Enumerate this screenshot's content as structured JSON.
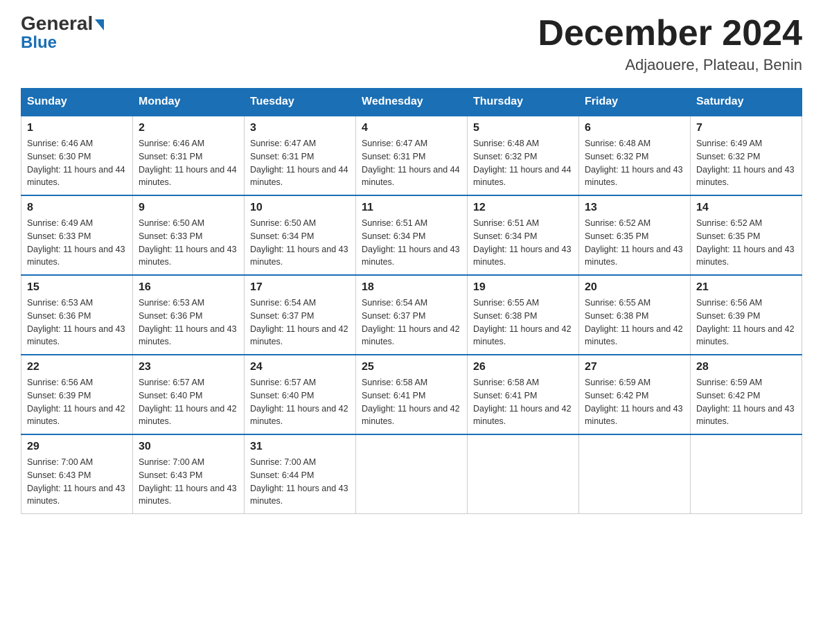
{
  "header": {
    "logo_line1": "General",
    "logo_line2": "Blue",
    "month_title": "December 2024",
    "location": "Adjaouere, Plateau, Benin"
  },
  "weekdays": [
    "Sunday",
    "Monday",
    "Tuesday",
    "Wednesday",
    "Thursday",
    "Friday",
    "Saturday"
  ],
  "weeks": [
    [
      {
        "day": "1",
        "sunrise": "6:46 AM",
        "sunset": "6:30 PM",
        "daylight": "11 hours and 44 minutes."
      },
      {
        "day": "2",
        "sunrise": "6:46 AM",
        "sunset": "6:31 PM",
        "daylight": "11 hours and 44 minutes."
      },
      {
        "day": "3",
        "sunrise": "6:47 AM",
        "sunset": "6:31 PM",
        "daylight": "11 hours and 44 minutes."
      },
      {
        "day": "4",
        "sunrise": "6:47 AM",
        "sunset": "6:31 PM",
        "daylight": "11 hours and 44 minutes."
      },
      {
        "day": "5",
        "sunrise": "6:48 AM",
        "sunset": "6:32 PM",
        "daylight": "11 hours and 44 minutes."
      },
      {
        "day": "6",
        "sunrise": "6:48 AM",
        "sunset": "6:32 PM",
        "daylight": "11 hours and 43 minutes."
      },
      {
        "day": "7",
        "sunrise": "6:49 AM",
        "sunset": "6:32 PM",
        "daylight": "11 hours and 43 minutes."
      }
    ],
    [
      {
        "day": "8",
        "sunrise": "6:49 AM",
        "sunset": "6:33 PM",
        "daylight": "11 hours and 43 minutes."
      },
      {
        "day": "9",
        "sunrise": "6:50 AM",
        "sunset": "6:33 PM",
        "daylight": "11 hours and 43 minutes."
      },
      {
        "day": "10",
        "sunrise": "6:50 AM",
        "sunset": "6:34 PM",
        "daylight": "11 hours and 43 minutes."
      },
      {
        "day": "11",
        "sunrise": "6:51 AM",
        "sunset": "6:34 PM",
        "daylight": "11 hours and 43 minutes."
      },
      {
        "day": "12",
        "sunrise": "6:51 AM",
        "sunset": "6:34 PM",
        "daylight": "11 hours and 43 minutes."
      },
      {
        "day": "13",
        "sunrise": "6:52 AM",
        "sunset": "6:35 PM",
        "daylight": "11 hours and 43 minutes."
      },
      {
        "day": "14",
        "sunrise": "6:52 AM",
        "sunset": "6:35 PM",
        "daylight": "11 hours and 43 minutes."
      }
    ],
    [
      {
        "day": "15",
        "sunrise": "6:53 AM",
        "sunset": "6:36 PM",
        "daylight": "11 hours and 43 minutes."
      },
      {
        "day": "16",
        "sunrise": "6:53 AM",
        "sunset": "6:36 PM",
        "daylight": "11 hours and 43 minutes."
      },
      {
        "day": "17",
        "sunrise": "6:54 AM",
        "sunset": "6:37 PM",
        "daylight": "11 hours and 42 minutes."
      },
      {
        "day": "18",
        "sunrise": "6:54 AM",
        "sunset": "6:37 PM",
        "daylight": "11 hours and 42 minutes."
      },
      {
        "day": "19",
        "sunrise": "6:55 AM",
        "sunset": "6:38 PM",
        "daylight": "11 hours and 42 minutes."
      },
      {
        "day": "20",
        "sunrise": "6:55 AM",
        "sunset": "6:38 PM",
        "daylight": "11 hours and 42 minutes."
      },
      {
        "day": "21",
        "sunrise": "6:56 AM",
        "sunset": "6:39 PM",
        "daylight": "11 hours and 42 minutes."
      }
    ],
    [
      {
        "day": "22",
        "sunrise": "6:56 AM",
        "sunset": "6:39 PM",
        "daylight": "11 hours and 42 minutes."
      },
      {
        "day": "23",
        "sunrise": "6:57 AM",
        "sunset": "6:40 PM",
        "daylight": "11 hours and 42 minutes."
      },
      {
        "day": "24",
        "sunrise": "6:57 AM",
        "sunset": "6:40 PM",
        "daylight": "11 hours and 42 minutes."
      },
      {
        "day": "25",
        "sunrise": "6:58 AM",
        "sunset": "6:41 PM",
        "daylight": "11 hours and 42 minutes."
      },
      {
        "day": "26",
        "sunrise": "6:58 AM",
        "sunset": "6:41 PM",
        "daylight": "11 hours and 42 minutes."
      },
      {
        "day": "27",
        "sunrise": "6:59 AM",
        "sunset": "6:42 PM",
        "daylight": "11 hours and 43 minutes."
      },
      {
        "day": "28",
        "sunrise": "6:59 AM",
        "sunset": "6:42 PM",
        "daylight": "11 hours and 43 minutes."
      }
    ],
    [
      {
        "day": "29",
        "sunrise": "7:00 AM",
        "sunset": "6:43 PM",
        "daylight": "11 hours and 43 minutes."
      },
      {
        "day": "30",
        "sunrise": "7:00 AM",
        "sunset": "6:43 PM",
        "daylight": "11 hours and 43 minutes."
      },
      {
        "day": "31",
        "sunrise": "7:00 AM",
        "sunset": "6:44 PM",
        "daylight": "11 hours and 43 minutes."
      },
      {
        "day": "",
        "sunrise": "",
        "sunset": "",
        "daylight": ""
      },
      {
        "day": "",
        "sunrise": "",
        "sunset": "",
        "daylight": ""
      },
      {
        "day": "",
        "sunrise": "",
        "sunset": "",
        "daylight": ""
      },
      {
        "day": "",
        "sunrise": "",
        "sunset": "",
        "daylight": ""
      }
    ]
  ],
  "labels": {
    "sunrise_prefix": "Sunrise: ",
    "sunset_prefix": "Sunset: ",
    "daylight_prefix": "Daylight: "
  }
}
